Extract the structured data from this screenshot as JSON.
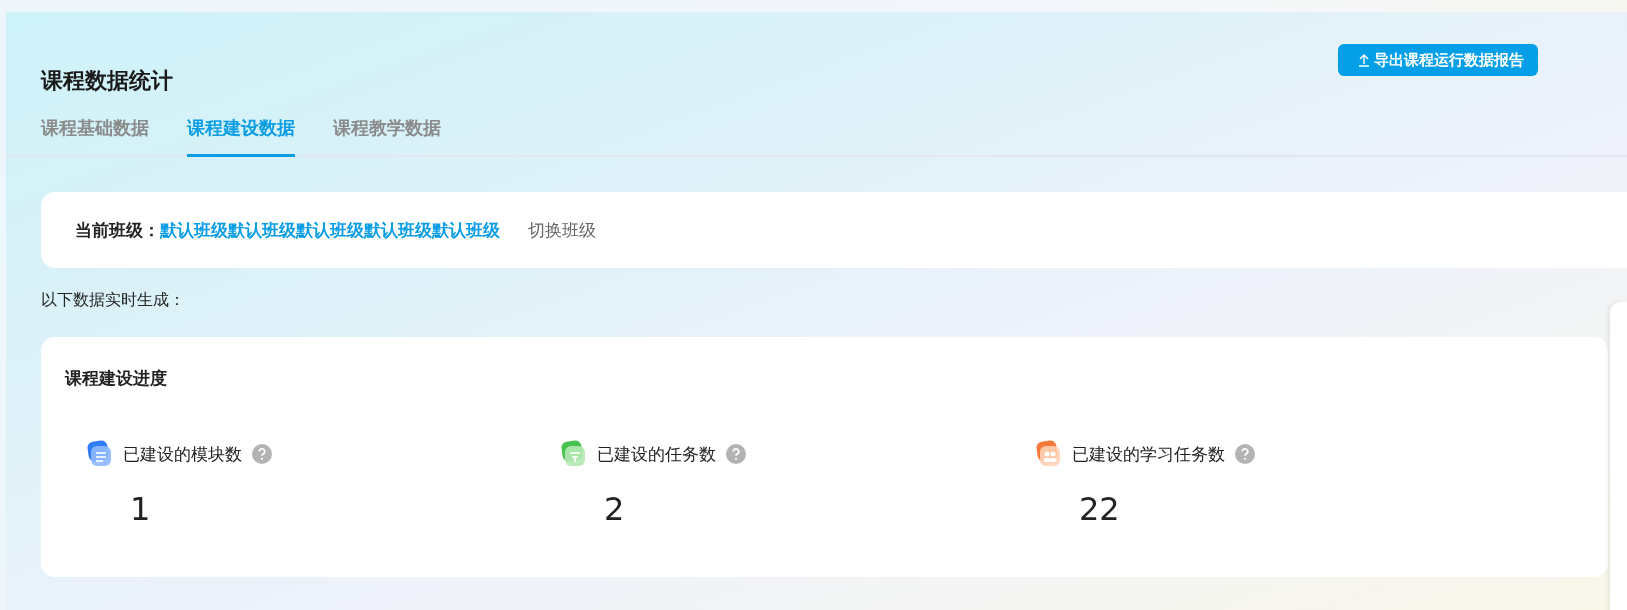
{
  "page": {
    "title": "课程数据统计",
    "export_button": "导出课程运行数据报告"
  },
  "tabs": [
    {
      "label": "课程基础数据",
      "selected": false
    },
    {
      "label": "课程建设数据",
      "selected": true
    },
    {
      "label": "课程教学数据",
      "selected": false
    }
  ],
  "class_bar": {
    "label": "当前班级：",
    "class_name": "默认班级默认班级默认班级默认班级默认班级",
    "switch_link": "切换班级"
  },
  "note": "以下数据实时生成：",
  "progress": {
    "title": "课程建设进度",
    "stats": [
      {
        "kind": "module",
        "label": "已建设的模块数",
        "value": "1"
      },
      {
        "kind": "task",
        "label": "已建设的任务数",
        "value": "2"
      },
      {
        "kind": "study",
        "label": "已建设的学习任务数",
        "value": "22"
      }
    ]
  }
}
